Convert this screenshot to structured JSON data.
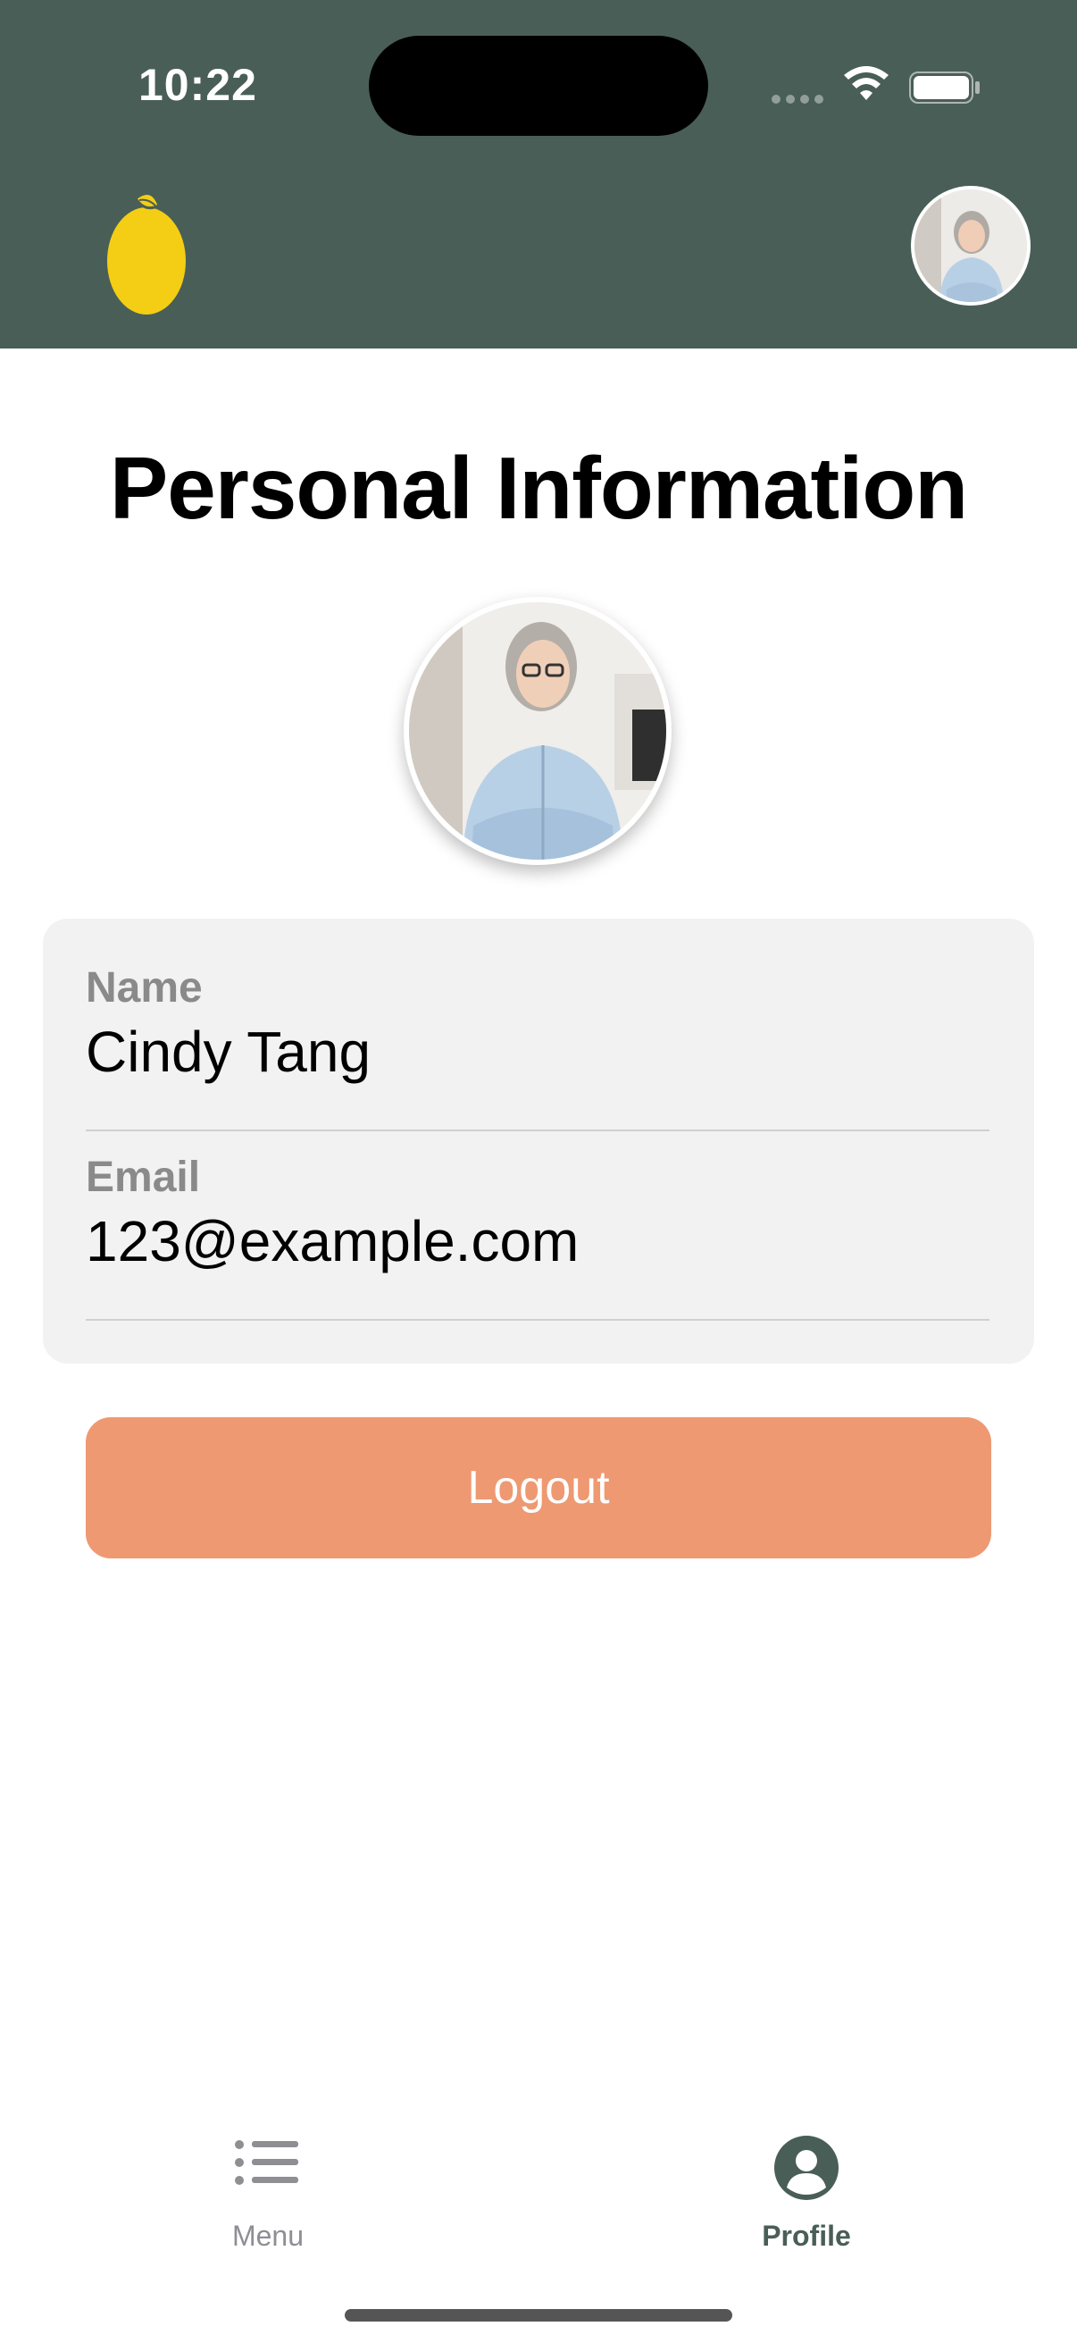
{
  "status_bar": {
    "time": "10:22"
  },
  "header": {
    "logo_icon": "lemon-logo-icon",
    "avatar_icon": "user-avatar"
  },
  "page": {
    "title": "Personal Information"
  },
  "profile": {
    "name_label": "Name",
    "name_value": "Cindy Tang",
    "email_label": "Email",
    "email_value": "123@example.com"
  },
  "actions": {
    "logout_label": "Logout"
  },
  "tabbar": {
    "items": [
      {
        "label": "Menu",
        "icon": "list-icon",
        "selected": false
      },
      {
        "label": "Profile",
        "icon": "person-circle-icon",
        "selected": true
      }
    ]
  },
  "colors": {
    "header_bg": "#495E57",
    "logout_bg": "#EE9972",
    "card_bg": "#F2F2F2",
    "accent": "#F4CE14"
  }
}
